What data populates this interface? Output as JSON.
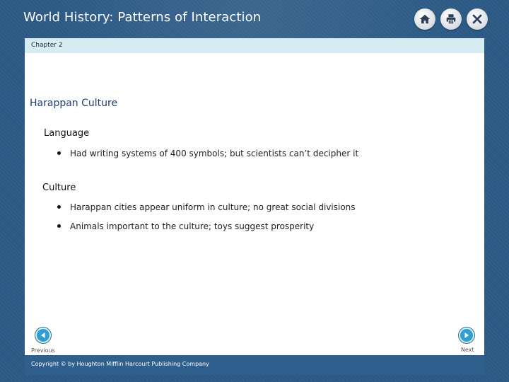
{
  "app": {
    "title": "World History: Patterns of Interaction"
  },
  "toolbar": {
    "buttons": [
      {
        "name": "home",
        "icon": "home-icon"
      },
      {
        "name": "print",
        "icon": "printer-icon"
      },
      {
        "name": "close",
        "icon": "close-icon"
      }
    ]
  },
  "chapter": {
    "label": "Chapter 2"
  },
  "content": {
    "heading": "Harappan Culture",
    "sections": [
      {
        "title": "Language",
        "bullets": [
          "Had writing systems of 400 symbols; but scientists can’t decipher it"
        ]
      },
      {
        "title": "Culture",
        "bullets": [
          "Harappan cities appear uniform in culture; no great social divisions",
          "Animals important to the culture; toys suggest prosperity"
        ]
      }
    ]
  },
  "nav": {
    "previous_label": "Previous",
    "next_label": "Next"
  },
  "footer": {
    "copyright": "Copyright © by Houghton Mifflin Harcourt Publishing Company"
  },
  "colors": {
    "background": "#2b5a86",
    "chapter_bar": "#d6ecf3",
    "heading": "#1f3d73",
    "nav_button": "#2e9fcf",
    "footer_bar": "#2f5f8c"
  }
}
